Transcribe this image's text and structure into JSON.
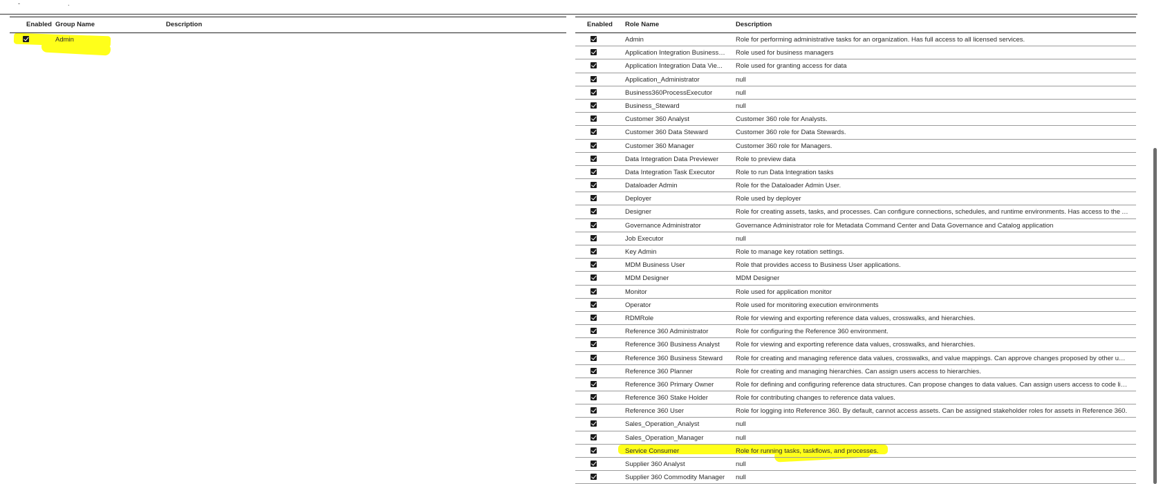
{
  "groups_table": {
    "headers": {
      "enabled": "Enabled",
      "name": "Group Name",
      "description": "Description"
    },
    "rows": [
      {
        "enabled": true,
        "name": "Admin",
        "description": ""
      }
    ]
  },
  "roles_table": {
    "headers": {
      "enabled": "Enabled",
      "name": "Role Name",
      "description": "Description"
    },
    "rows": [
      {
        "enabled": true,
        "name": "Admin",
        "description": "Role for performing administrative tasks for an organization. Has full access to all licensed services."
      },
      {
        "enabled": true,
        "name": "Application Integration Business ...",
        "description": "Role used for business managers"
      },
      {
        "enabled": true,
        "name": "Application Integration Data Vie...",
        "description": "Role used for granting access for data"
      },
      {
        "enabled": true,
        "name": "Application_Administrator",
        "description": "null"
      },
      {
        "enabled": true,
        "name": "Business360ProcessExecutor",
        "description": "null"
      },
      {
        "enabled": true,
        "name": "Business_Steward",
        "description": "null"
      },
      {
        "enabled": true,
        "name": "Customer 360 Analyst",
        "description": "Customer 360 role for Analysts."
      },
      {
        "enabled": true,
        "name": "Customer 360 Data Steward",
        "description": "Customer 360 role for Data Stewards."
      },
      {
        "enabled": true,
        "name": "Customer 360 Manager",
        "description": "Customer 360 role for Managers."
      },
      {
        "enabled": true,
        "name": "Data Integration Data Previewer",
        "description": "Role to preview data"
      },
      {
        "enabled": true,
        "name": "Data Integration Task Executor",
        "description": "Role to run Data Integration tasks"
      },
      {
        "enabled": true,
        "name": "Dataloader Admin",
        "description": "Role for the Dataloader Admin User."
      },
      {
        "enabled": true,
        "name": "Deployer",
        "description": "Role used by deployer"
      },
      {
        "enabled": true,
        "name": "Designer",
        "description": "Role for creating assets, tasks, and processes. Can configure connections, schedules, and runtime environments. Has access to the Applicati..."
      },
      {
        "enabled": true,
        "name": "Governance Administrator",
        "description": "Governance Administrator role for Metadata Command Center and Data Governance and Catalog application"
      },
      {
        "enabled": true,
        "name": "Job Executor",
        "description": "null"
      },
      {
        "enabled": true,
        "name": "Key Admin",
        "description": "Role to manage key rotation settings."
      },
      {
        "enabled": true,
        "name": "MDM Business User",
        "description": "Role that provides access to Business User applications."
      },
      {
        "enabled": true,
        "name": "MDM Designer",
        "description": "MDM Designer"
      },
      {
        "enabled": true,
        "name": "Monitor",
        "description": "Role used for application monitor"
      },
      {
        "enabled": true,
        "name": "Operator",
        "description": "Role used for monitoring execution environments"
      },
      {
        "enabled": true,
        "name": "RDMRole",
        "description": "Role for viewing and exporting reference data values, crosswalks, and hierarchies."
      },
      {
        "enabled": true,
        "name": "Reference 360 Administrator",
        "description": "Role for configuring the Reference 360 environment."
      },
      {
        "enabled": true,
        "name": "Reference 360 Business Analyst",
        "description": "Role for viewing and exporting reference data values, crosswalks, and hierarchies."
      },
      {
        "enabled": true,
        "name": "Reference 360 Business Steward",
        "description": "Role for creating and managing reference data values, crosswalks, and value mappings. Can approve changes proposed by other users. C..."
      },
      {
        "enabled": true,
        "name": "Reference 360 Planner",
        "description": "Role for creating and managing hierarchies. Can assign users access to hierarchies."
      },
      {
        "enabled": true,
        "name": "Reference 360 Primary Owner",
        "description": "Role for defining and configuring reference data structures. Can propose changes to data values. Can assign users access to code lists and ..."
      },
      {
        "enabled": true,
        "name": "Reference 360 Stake Holder",
        "description": "Role for contributing changes to reference data values."
      },
      {
        "enabled": true,
        "name": "Reference 360 User",
        "description": "Role for logging into Reference 360. By default, cannot access assets. Can be assigned stakeholder roles for assets in Reference 360."
      },
      {
        "enabled": true,
        "name": "Sales_Operation_Analyst",
        "description": "null"
      },
      {
        "enabled": true,
        "name": "Sales_Operation_Manager",
        "description": "null"
      },
      {
        "enabled": true,
        "name": "Service Consumer",
        "description": "Role for running tasks, taskflows, and processes."
      },
      {
        "enabled": true,
        "name": "Supplier 360 Analyst",
        "description": "null"
      },
      {
        "enabled": true,
        "name": "Supplier 360 Commodity Manager",
        "description": "null"
      }
    ]
  },
  "colors": {
    "highlight": "#ffff1a",
    "checkbox": "#1a1a1a"
  }
}
